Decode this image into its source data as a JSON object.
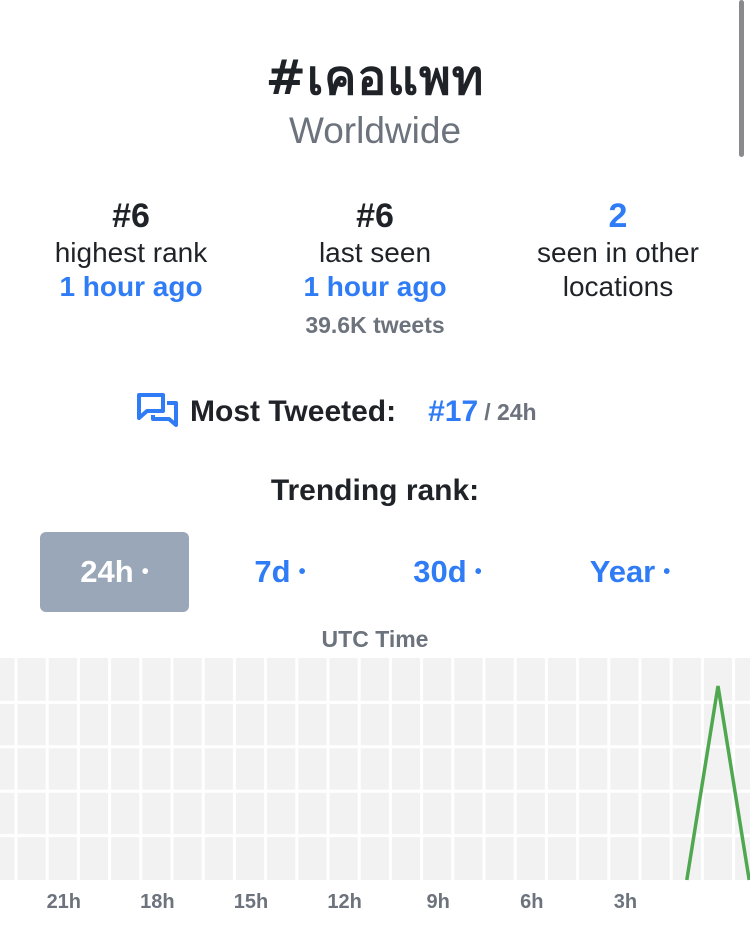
{
  "header": {
    "title": "#เคอแพท",
    "subtitle": "Worldwide"
  },
  "stats": [
    {
      "value": "#6",
      "label": "highest rank",
      "time": "1 hour ago",
      "extra": ""
    },
    {
      "value": "#6",
      "label": "last seen",
      "time": "1 hour ago",
      "extra": "39.6K tweets"
    },
    {
      "value": "2",
      "label_line1": "seen in other",
      "label_line2": "locations"
    }
  ],
  "most_tweeted": {
    "icon": "chat-bubbles-icon",
    "label": "Most Tweeted:",
    "rank": "#17",
    "period": "/ 24h"
  },
  "trending": {
    "heading": "Trending rank:",
    "tabs": [
      {
        "label": "24h",
        "dot": "•",
        "active": true
      },
      {
        "label": "7d",
        "dot": "•",
        "active": false
      },
      {
        "label": "30d",
        "dot": "•",
        "active": false
      },
      {
        "label": "Year",
        "dot": "•",
        "active": false
      }
    ],
    "axis_title": "UTC Time"
  },
  "colors": {
    "accent": "#2f7cf6",
    "muted": "#6c737d",
    "active_tab_bg": "#9aa7b8",
    "line": "#4fa84f",
    "grid_bg": "#f2f2f2"
  },
  "chart_data": {
    "type": "line",
    "xlabel": "UTC Time",
    "x_tick_labels": [
      "21h",
      "18h",
      "15h",
      "12h",
      "9h",
      "6h",
      "3h"
    ],
    "series": [
      {
        "x_hours_ago": [
          1.0,
          0.0,
          -1.0
        ],
        "rank": [
          null,
          6,
          null
        ]
      }
    ],
    "grid": true
  }
}
